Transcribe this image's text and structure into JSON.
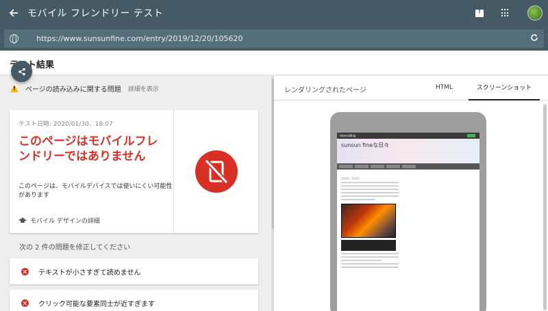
{
  "topbar": {
    "title": "モバイル フレンドリー テスト",
    "back_icon": "arrow-back-icon",
    "feedback_icon": "feedback-icon",
    "apps_icon": "apps-grid-icon"
  },
  "urlbar": {
    "url": "https://www.sunsunfine.com/entry/2019/12/20/105620",
    "reload_icon": "reload-icon"
  },
  "results": {
    "title": "テスト結果"
  },
  "issues_bar": {
    "text": "ページの読み込みに関する問題",
    "detail_link": "詳細を表示"
  },
  "result_card": {
    "test_date": "テスト日時: 2020/01/30、18:07",
    "verdict": "このページはモバイルフレンドリーではありません",
    "description": "このページは、モバイルデバイスでは使いにくい可能性があります",
    "design_link": "モバイル デザインの詳細"
  },
  "fix": {
    "title": "次の 2 件の問題を修正してください",
    "problems": [
      {
        "label": "テキストが小さすぎて読めません"
      },
      {
        "label": "クリック可能な要素同士が近すぎます"
      }
    ]
  },
  "right_panel": {
    "title": "レンダリングされたページ",
    "tabs": [
      {
        "label": "HTML",
        "selected": false
      },
      {
        "label": "スクリーンショット",
        "selected": true
      }
    ]
  },
  "screenshot": {
    "blog_name": "sunsun fineな日々",
    "header_label": "HatenaBlog"
  },
  "colors": {
    "appbar": "#455a64",
    "error_red": "#d93025",
    "warning_yellow": "#fbbc04"
  }
}
